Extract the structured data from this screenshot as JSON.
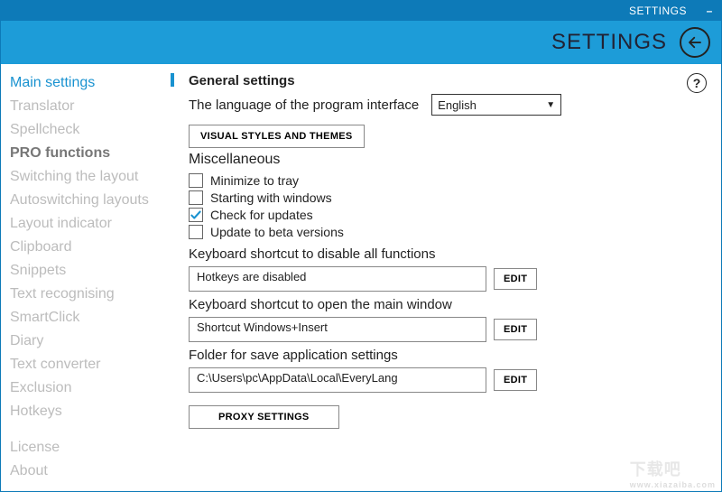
{
  "window": {
    "title": "SETTINGS",
    "header": "SETTINGS"
  },
  "sidebar": {
    "items": [
      {
        "label": "Main settings",
        "state": "sel"
      },
      {
        "label": "Translator",
        "state": ""
      },
      {
        "label": "Spellcheck",
        "state": ""
      },
      {
        "label": "PRO functions",
        "state": "bold"
      },
      {
        "label": "Switching the layout",
        "state": ""
      },
      {
        "label": "Autoswitching layouts",
        "state": ""
      },
      {
        "label": "Layout indicator",
        "state": ""
      },
      {
        "label": "Clipboard",
        "state": ""
      },
      {
        "label": "Snippets",
        "state": ""
      },
      {
        "label": "Text recognising",
        "state": ""
      },
      {
        "label": "SmartClick",
        "state": ""
      },
      {
        "label": "Diary",
        "state": ""
      },
      {
        "label": "Text converter",
        "state": ""
      },
      {
        "label": "Exclusion",
        "state": ""
      },
      {
        "label": "Hotkeys",
        "state": ""
      }
    ],
    "footer": [
      {
        "label": "License"
      },
      {
        "label": "About"
      }
    ]
  },
  "content": {
    "general_title": "General settings",
    "language_label": "The language of the program interface",
    "language_value": "English",
    "visual_styles_btn": "Visual styles and themes",
    "misc_title": "Miscellaneous",
    "checks": [
      {
        "label": "Minimize to tray",
        "checked": false
      },
      {
        "label": "Starting with windows",
        "checked": false
      },
      {
        "label": "Check for updates",
        "checked": true
      },
      {
        "label": "Update to beta versions",
        "checked": false
      }
    ],
    "shortcut1_label": "Keyboard shortcut to disable all functions",
    "shortcut1_value": "Hotkeys are disabled",
    "shortcut2_label": "Keyboard shortcut to open the main window",
    "shortcut2_value": "Shortcut Windows+Insert",
    "folder_label": "Folder for save application settings",
    "folder_value": "C:\\Users\\pc\\AppData\\Local\\EveryLang",
    "edit_btn": "Edit",
    "proxy_btn": "Proxy settings",
    "help": "?"
  },
  "watermark": {
    "big": "下载吧",
    "small": "www.xiazaiba.com"
  }
}
